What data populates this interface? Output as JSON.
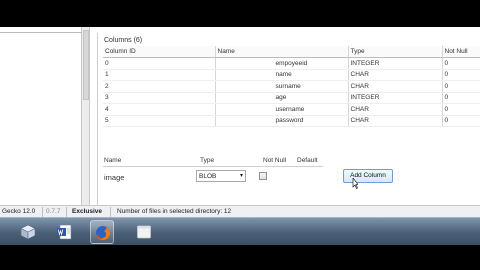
{
  "columns_section": {
    "title": "Columns (6)",
    "headers": [
      "Column ID",
      "Name",
      "Type",
      "Not Null"
    ],
    "rows": [
      {
        "id": "0",
        "name": "empoyeeid",
        "type": "INTEGER",
        "not_null": "0"
      },
      {
        "id": "1",
        "name": "name",
        "type": "CHAR",
        "not_null": "0"
      },
      {
        "id": "2",
        "name": "surname",
        "type": "CHAR",
        "not_null": "0"
      },
      {
        "id": "3",
        "name": "age",
        "type": "INTEGER",
        "not_null": "0"
      },
      {
        "id": "4",
        "name": "username",
        "type": "CHAR",
        "not_null": "0"
      },
      {
        "id": "5",
        "name": "password",
        "type": "CHAR",
        "not_null": "0"
      }
    ]
  },
  "new_column_form": {
    "labels": {
      "name": "Name",
      "type": "Type",
      "not_null": "Not Null",
      "default": "Default"
    },
    "name_value": "image",
    "type_value": "BLOB",
    "type_arrow": "▾",
    "not_null_checked": false,
    "add_button": "Add Column"
  },
  "status_bar": {
    "engine": "Gecko 12.0",
    "version": "0.7.7",
    "mode": "Exclusive",
    "files_text": "Number of files in selected directory: 12"
  },
  "taskbar": {
    "items": [
      {
        "icon": "cube-app-icon",
        "active": false
      },
      {
        "icon": "word-document-icon",
        "active": false
      },
      {
        "icon": "firefox-icon",
        "active": true
      },
      {
        "icon": "window-app-icon",
        "active": false
      }
    ]
  },
  "colors": {
    "button_border": "#6f9fd8",
    "taskbar": "#4b6077"
  }
}
